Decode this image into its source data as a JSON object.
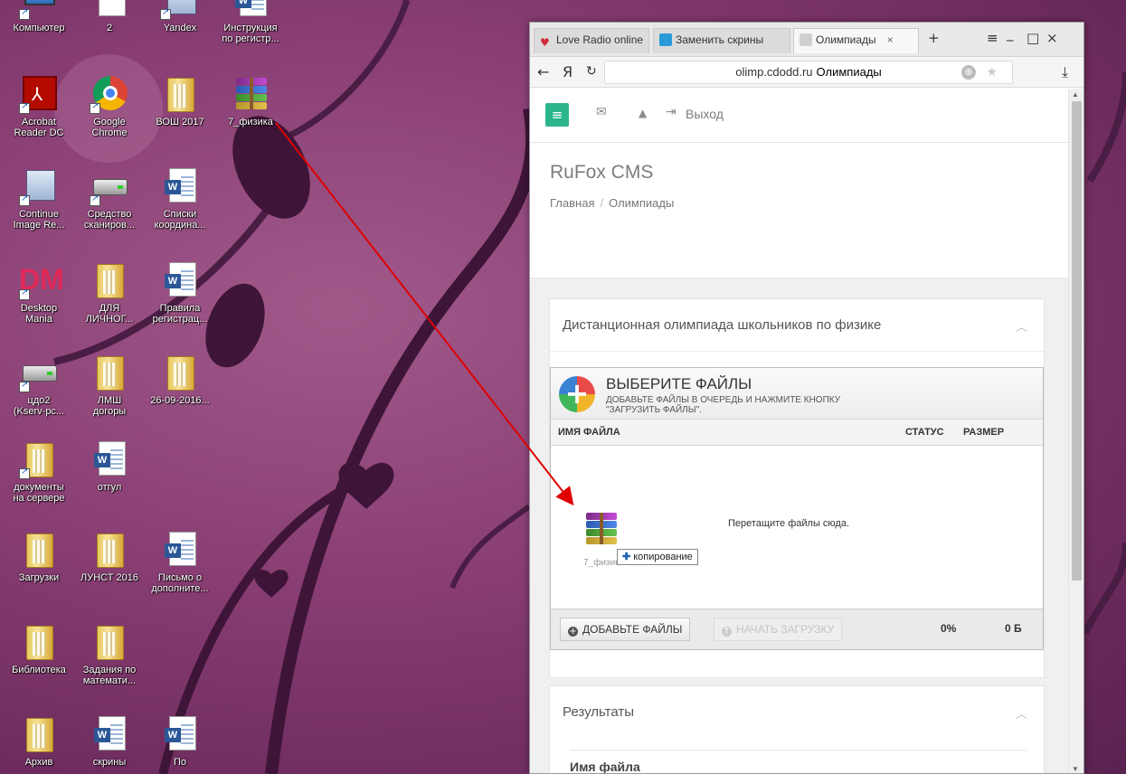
{
  "desktop": {
    "icons": [
      {
        "label": "Компьютер",
        "type": "computer"
      },
      {
        "label": "2",
        "type": "doc"
      },
      {
        "label": "Yandex",
        "type": "app"
      },
      {
        "label": "Инструкция\nпо регистр...",
        "type": "word"
      },
      {
        "label": "Acrobat\nReader DC",
        "type": "acrobat"
      },
      {
        "label": "Google\nChrome",
        "type": "chrome"
      },
      {
        "label": "ВОШ 2017",
        "type": "folder"
      },
      {
        "label": "7_физика",
        "type": "rar"
      },
      {
        "label": "Continue\nImage Re...",
        "type": "app"
      },
      {
        "label": "Средство\nсканиров...",
        "type": "scanner"
      },
      {
        "label": "Списки\nкоордина...",
        "type": "word"
      },
      {
        "label": "Desktop\nMania",
        "type": "dm"
      },
      {
        "label": "ДЛЯ\nЛИЧНОГ...",
        "type": "folder"
      },
      {
        "label": "Правила\nрегистрац...",
        "type": "word"
      },
      {
        "label": "цдо2\n(Kserv-pc...",
        "type": "drive"
      },
      {
        "label": "ЛМШ\nдогоры",
        "type": "folder"
      },
      {
        "label": "26-09-2016...",
        "type": "folder"
      },
      {
        "label": "документы\nна сервере",
        "type": "netfolder"
      },
      {
        "label": "отгул",
        "type": "word"
      },
      {
        "label": "Загрузки",
        "type": "folder"
      },
      {
        "label": "ЛУНСТ 2016",
        "type": "folder"
      },
      {
        "label": "Письмо о\nдополните...",
        "type": "word"
      },
      {
        "label": "Библиотека",
        "type": "folder"
      },
      {
        "label": "Задания по\nматемати...",
        "type": "folder"
      },
      {
        "label": "Архив",
        "type": "folder"
      },
      {
        "label": "скрины",
        "type": "word"
      },
      {
        "label": "По",
        "type": "word"
      }
    ]
  },
  "browser": {
    "tabs": [
      {
        "label": "Love Radio online",
        "icon": "heart-icon",
        "color": "#d02b3a"
      },
      {
        "label": "Заменить скрины",
        "icon": "site-icon",
        "color": "#2a9bd8"
      },
      {
        "label": "Олимпиады",
        "icon": "page-icon",
        "color": "#cfcfcf"
      }
    ],
    "tab_close": "×",
    "new_tab": "+",
    "window_controls": {
      "menu": "≡",
      "minimize": "_",
      "maximize": "□",
      "close": "×"
    },
    "nav": {
      "back": "←",
      "home": "Я",
      "reload": "↻",
      "download": "⤓"
    },
    "url": {
      "host": "olimp.cdodd.ru",
      "page_title": "Олимпиады"
    }
  },
  "site": {
    "topnav": {
      "menu_icon": "≡",
      "mail_icon": "✉",
      "bell_icon": "🔔",
      "logout_icon": "⇥",
      "logout_label": "Выход"
    },
    "title": "RuFox CMS",
    "breadcrumb": {
      "home": "Главная",
      "separator": "/",
      "current": "Олимпиады"
    },
    "olympiad_panel": {
      "title": "Дистанционная олимпиада школьников по физике",
      "caret": "^"
    },
    "uploader": {
      "title": "ВЫБЕРИТЕ ФАЙЛЫ",
      "hint": "ДОБАВЬТЕ ФАЙЛЫ В ОЧЕРЕДЬ И НАЖМИТЕ КНОПКУ \"ЗАГРУЗИТЬ ФАЙЛЫ\".",
      "columns": {
        "name": "ИМЯ ФАЙЛА",
        "status": "СТАТУС",
        "size": "РАЗМЕР"
      },
      "drop_text": "Перетащите файлы сюда.",
      "drag_file_label": "7_физика",
      "copy_tooltip": "копирование",
      "add_button": "ДОБАВЬТЕ ФАЙЛЫ",
      "start_button": "НАЧАТЬ ЗАГРУЗКУ",
      "percent": "0%",
      "total_size": "0 Б"
    },
    "results_panel": {
      "title": "Результаты",
      "caret": "^",
      "column": "Имя файла"
    }
  }
}
